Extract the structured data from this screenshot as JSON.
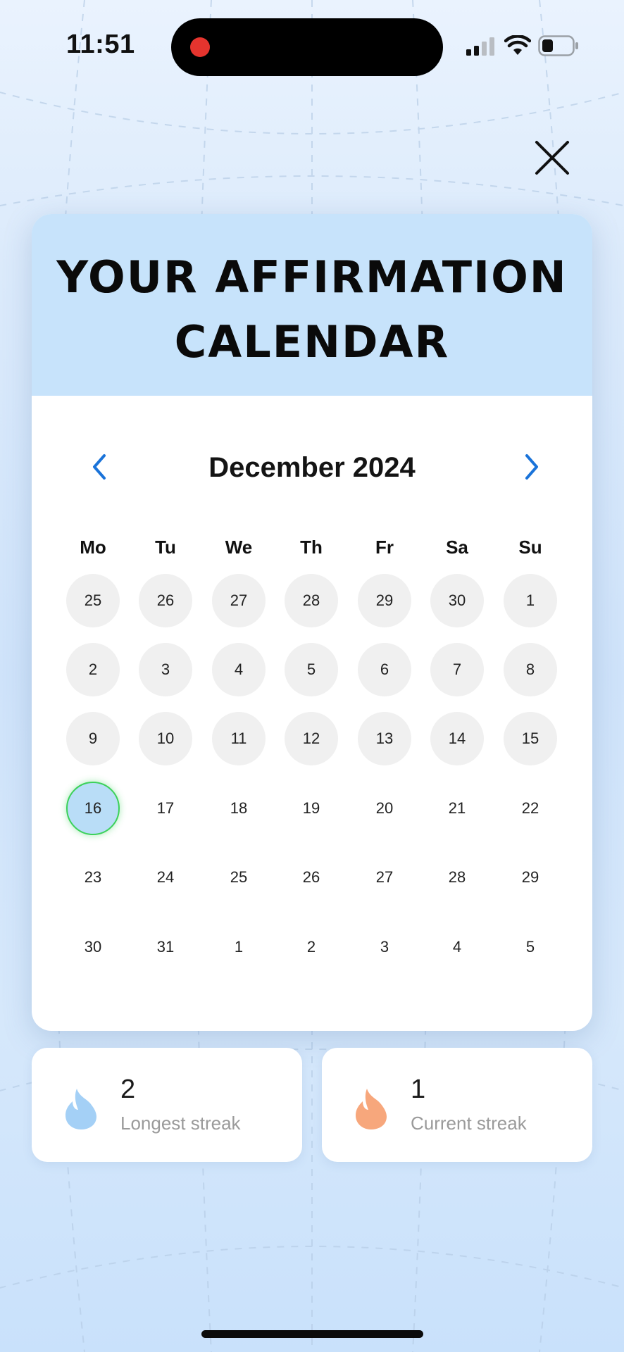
{
  "status_bar": {
    "time": "11:51"
  },
  "close": {
    "icon": "close-icon"
  },
  "calendar": {
    "title_line1": "YOUR AFFIRMATION",
    "title_line2": "CALENDAR",
    "month_label": "December 2024",
    "weekdays": [
      "Mo",
      "Tu",
      "We",
      "Th",
      "Fr",
      "Sa",
      "Su"
    ],
    "weeks": [
      [
        {
          "label": "25",
          "state": "done"
        },
        {
          "label": "26",
          "state": "done"
        },
        {
          "label": "27",
          "state": "done"
        },
        {
          "label": "28",
          "state": "done"
        },
        {
          "label": "29",
          "state": "done"
        },
        {
          "label": "30",
          "state": "done"
        },
        {
          "label": "1",
          "state": "done"
        }
      ],
      [
        {
          "label": "2",
          "state": "done"
        },
        {
          "label": "3",
          "state": "done"
        },
        {
          "label": "4",
          "state": "done"
        },
        {
          "label": "5",
          "state": "done"
        },
        {
          "label": "6",
          "state": "done"
        },
        {
          "label": "7",
          "state": "done"
        },
        {
          "label": "8",
          "state": "done"
        }
      ],
      [
        {
          "label": "9",
          "state": "done"
        },
        {
          "label": "10",
          "state": "done"
        },
        {
          "label": "11",
          "state": "done"
        },
        {
          "label": "12",
          "state": "done"
        },
        {
          "label": "13",
          "state": "done"
        },
        {
          "label": "14",
          "state": "done"
        },
        {
          "label": "15",
          "state": "done"
        }
      ],
      [
        {
          "label": "16",
          "state": "today"
        },
        {
          "label": "17",
          "state": "plain"
        },
        {
          "label": "18",
          "state": "plain"
        },
        {
          "label": "19",
          "state": "plain"
        },
        {
          "label": "20",
          "state": "plain"
        },
        {
          "label": "21",
          "state": "plain"
        },
        {
          "label": "22",
          "state": "plain"
        }
      ],
      [
        {
          "label": "23",
          "state": "plain"
        },
        {
          "label": "24",
          "state": "plain"
        },
        {
          "label": "25",
          "state": "plain"
        },
        {
          "label": "26",
          "state": "plain"
        },
        {
          "label": "27",
          "state": "plain"
        },
        {
          "label": "28",
          "state": "plain"
        },
        {
          "label": "29",
          "state": "plain"
        }
      ],
      [
        {
          "label": "30",
          "state": "plain"
        },
        {
          "label": "31",
          "state": "plain"
        },
        {
          "label": "1",
          "state": "plain"
        },
        {
          "label": "2",
          "state": "plain"
        },
        {
          "label": "3",
          "state": "plain"
        },
        {
          "label": "4",
          "state": "plain"
        },
        {
          "label": "5",
          "state": "plain"
        }
      ]
    ]
  },
  "streaks": {
    "longest": {
      "value": "2",
      "label": "Longest streak",
      "color": "#a4d0f6"
    },
    "current": {
      "value": "1",
      "label": "Current streak",
      "color": "#f7a77c"
    }
  },
  "colors": {
    "accent": "#1a73d9",
    "header_bg": "#c7e3fb",
    "done_day": "#f0f0f0",
    "today_ring": "#3cd15a"
  }
}
